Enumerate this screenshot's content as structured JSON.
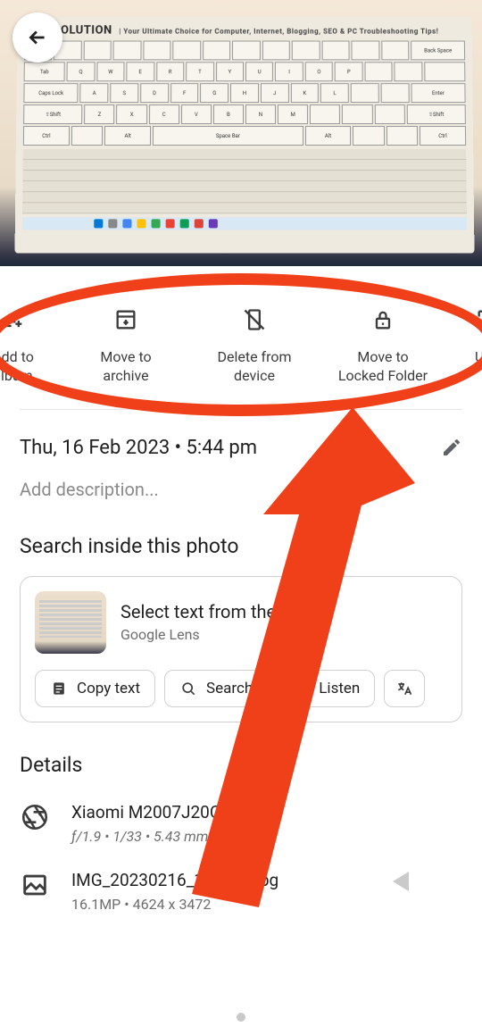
{
  "top_photo": {
    "header_text": "s PC SOLUTION",
    "header_tagline": "| Your Ultimate Choice for Computer, Internet, Blogging, SEO & PC Troubleshooting Tips!"
  },
  "actions": {
    "add_album": "Add to album",
    "move_archive": "Move to archive",
    "delete_device": "Delete from device",
    "move_locked": "Move to Locked Folder",
    "use_as": "Use"
  },
  "info": {
    "datetime": "Thu, 16 Feb 2023  •  5:44 pm",
    "description_placeholder": "Add description..."
  },
  "search": {
    "title": "Search inside this photo",
    "lens_title": "Select text from the image",
    "lens_subtitle": "Google Lens",
    "copy_text": "Copy text",
    "search_btn": "Search",
    "listen_btn": "Listen",
    "translate_btn": ""
  },
  "details": {
    "title": "Details",
    "device": {
      "name": "Xiaomi M2007J20CI",
      "meta": "ƒ/1.9  •  1/33  •  5.43 mm  •  ISO382"
    },
    "file": {
      "name": "IMG_20230216_174446.jpg",
      "meta": "16.1MP  •  4624 x 3472"
    }
  },
  "icons": {
    "back": "back-arrow-icon",
    "add_album": "add-to-album-icon",
    "archive": "archive-icon",
    "delete": "delete-device-icon",
    "lock": "lock-icon",
    "wallpaper": "wallpaper-icon",
    "pencil": "pencil-icon",
    "copytext": "document-icon",
    "search": "lens-search-icon",
    "listen": "speaker-icon",
    "translate": "translate-icon",
    "aperture": "aperture-icon",
    "image": "image-file-icon"
  }
}
